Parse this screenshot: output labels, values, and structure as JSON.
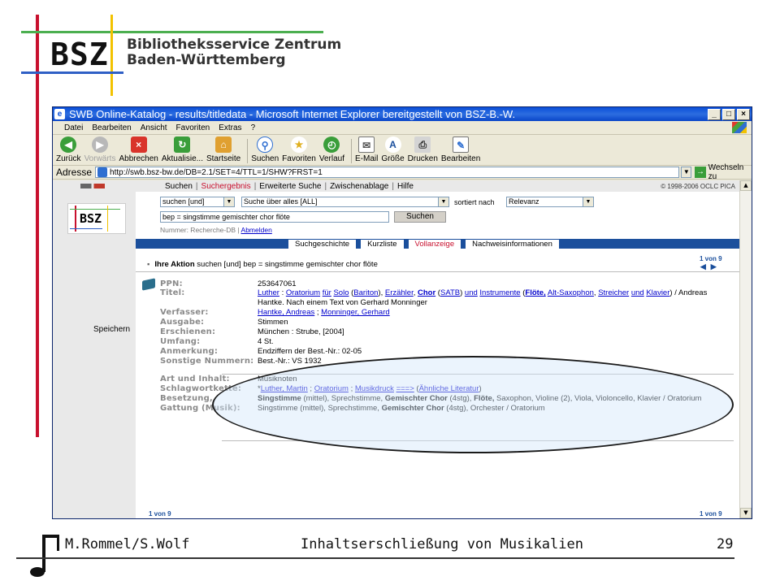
{
  "slide": {
    "logo": "BSZ",
    "org_line1": "Bibliotheksservice Zentrum",
    "org_line2": "Baden-Württemberg",
    "footer_author": "M.Rommel/S.Wolf",
    "footer_title": "Inhaltserschließung von Musikalien",
    "footer_page": "29"
  },
  "window": {
    "title": "SWB Online-Katalog - results/titledata - Microsoft Internet Explorer bereitgestellt von BSZ-B.-W.",
    "menu": [
      "Datei",
      "Bearbeiten",
      "Ansicht",
      "Favoriten",
      "Extras",
      "?"
    ],
    "toolbar": [
      "Zurück",
      "Vorwärts",
      "Abbrechen",
      "Aktualisie...",
      "Startseite",
      "Suchen",
      "Favoriten",
      "Verlauf",
      "E-Mail",
      "Größe",
      "Drucken",
      "Bearbeiten"
    ],
    "address_label": "Adresse",
    "address_url": "http://swb.bsz-bw.de/DB=2.1/SET=4/TTL=1/SHW?FRST=1",
    "go_label": "Wechseln zu"
  },
  "page": {
    "nav": [
      "Suchen",
      "Suchergebnis",
      "Erweiterte Suche",
      "Zwischenablage",
      "Hilfe"
    ],
    "copyright": "© 1998-2006 OCLC PICA",
    "sidebar_logo": "BSZ",
    "speichern": "Speichern",
    "search_mode": "suchen [und]",
    "search_field": "Suche über alles [ALL]",
    "sort_label": "sortiert nach",
    "sort_value": "Relevanz",
    "search_value": "bep = singstimme gemischter chor flöte",
    "search_button": "Suchen",
    "db_info": "Nummer: Recherche-DB |",
    "db_link": "Abmelden",
    "tabs": [
      "Suchgeschichte",
      "Kurzliste",
      "Vollanzeige",
      "Nachweisinformationen"
    ],
    "action_label": "Ihre Aktion",
    "action_text": "suchen [und]  bep = singstimme gemischter chor flöte",
    "pager": "1 von 9",
    "record": {
      "ppn_label": "PPN:",
      "ppn": "253647061",
      "titel_label": "Titel:",
      "verfasser_label": "Verfasser:",
      "verfasser_1": "Hantke, Andreas",
      "verfasser_2": "Monninger, Gerhard",
      "ausgabe_label": "Ausgabe:",
      "ausgabe": "Stimmen",
      "erschienen_label": "Erschienen:",
      "erschienen": "München : Strube, [2004]",
      "umfang_label": "Umfang:",
      "umfang": "4 St.",
      "anmerkung_label": "Anmerkung:",
      "anmerkung": "Endziffern der Best.-Nr.: 02-05",
      "sonstige_label": "Sonstige Nummern:",
      "sonstige": "Best.-Nr.: VS 1932",
      "art_label": "Art und Inhalt:",
      "art": "Musiknoten",
      "schlag_label": "Schlagwortkette:",
      "besetzung_label": "Besetzung,",
      "gattung_label": "Gattung (Musik):"
    }
  }
}
